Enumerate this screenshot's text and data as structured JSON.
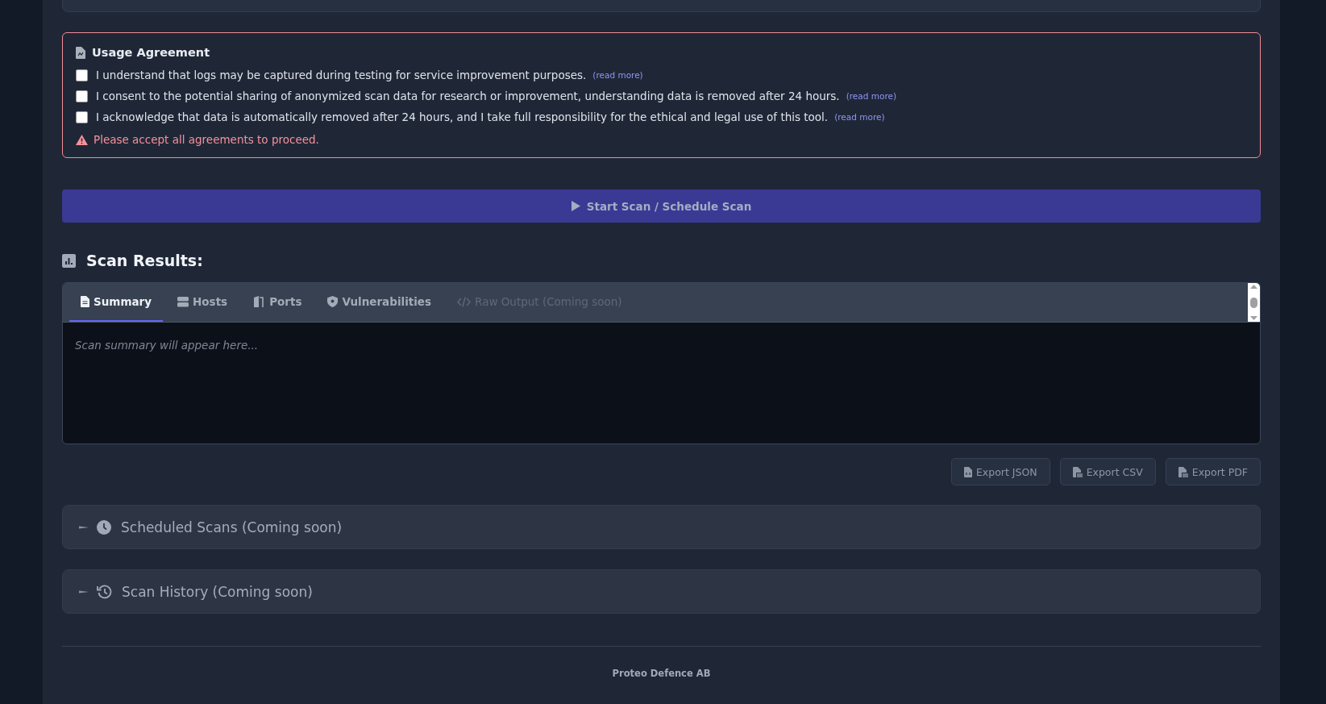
{
  "agreement": {
    "title": "Usage Agreement",
    "items": [
      {
        "text": "I understand that logs may be captured during testing for service improvement purposes.",
        "link": "(read more)",
        "checked": false
      },
      {
        "text": "I consent to the potential sharing of anonymized scan data for research or improvement, understanding data is removed after 24 hours.",
        "link": "(read more)",
        "checked": false
      },
      {
        "text": "I acknowledge that data is automatically removed after 24 hours, and I take full responsibility for the ethical and legal use of this tool.",
        "link": "(read more)",
        "checked": false
      }
    ],
    "warning": "Please accept all agreements to proceed."
  },
  "start_button": "Start Scan / Schedule Scan",
  "results": {
    "title": "Scan Results:",
    "tabs": [
      {
        "kind": "doc",
        "label": "Summary",
        "selected": true,
        "disabled": false
      },
      {
        "kind": "server",
        "label": "Hosts",
        "selected": false,
        "disabled": false
      },
      {
        "kind": "door",
        "label": "Ports",
        "selected": false,
        "disabled": false
      },
      {
        "kind": "shield",
        "label": "Vulnerabilities",
        "selected": false,
        "disabled": false
      },
      {
        "kind": "code",
        "label": "Raw Output (Coming soon)",
        "selected": false,
        "disabled": true
      }
    ],
    "placeholder": "Scan summary will appear here..."
  },
  "exports": [
    {
      "kind": "json",
      "label": "Export JSON"
    },
    {
      "kind": "csv",
      "label": "Export CSV"
    },
    {
      "kind": "pdf",
      "label": "Export PDF"
    }
  ],
  "sections": [
    {
      "kind": "clock",
      "title": "Scheduled Scans (Coming soon)",
      "expanded": false
    },
    {
      "kind": "history",
      "title": "Scan History (Coming soon)",
      "expanded": false
    }
  ],
  "footer": "Proteo Defence AB"
}
